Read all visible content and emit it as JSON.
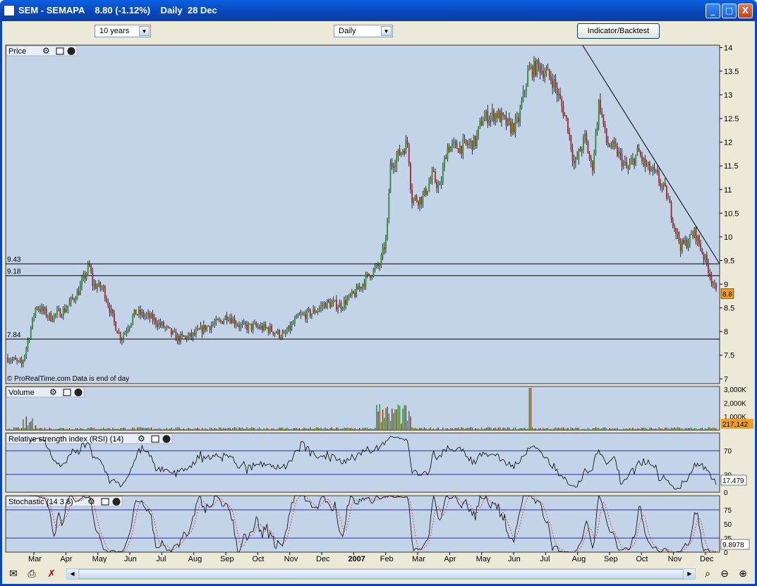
{
  "window": {
    "title": "SEM - SEMAPA    8.80 (-1.12%)    Daily  28 Dec",
    "minimize": "_",
    "maximize": "□",
    "close": "X"
  },
  "toolbar": {
    "period_select": "10 years",
    "interval_select": "Daily",
    "indicator_button": "Indicator/Backtest"
  },
  "colors": {
    "panel_bg": "#c4d4e8",
    "up": "#2a8c2a",
    "down": "#b02020",
    "line": "#000000",
    "reference": "#3030a0",
    "badge": "#f0a020"
  },
  "panels": {
    "price": {
      "title": "Price",
      "current_label": "8.8",
      "watermark": "© ProRealTime.com  Data is end of day"
    },
    "volume": {
      "title": "Volume",
      "current_label": "217,142"
    },
    "rsi": {
      "title": "Relative strength index (RSI) (14)",
      "current_label": "17.479"
    },
    "stoch": {
      "title": "Stochastic (14 3 5)",
      "current_label": "9.8978"
    }
  },
  "chart_data": [
    {
      "type": "candlestick",
      "title": "Price",
      "x_labels": [
        "Mar",
        "Apr",
        "May",
        "Jun",
        "Jul",
        "Aug",
        "Sep",
        "Oct",
        "Nov",
        "Dec",
        "2007",
        "Feb",
        "Mar",
        "Apr",
        "May",
        "Jun",
        "Jul",
        "Aug",
        "Sep",
        "Oct",
        "Nov",
        "Dec"
      ],
      "y_ticks": [
        7,
        7.5,
        8,
        8.5,
        9,
        9.5,
        10,
        10.5,
        11,
        11.5,
        12,
        12.5,
        13,
        13.5,
        14
      ],
      "ylim": [
        6.9,
        14.05
      ],
      "horizontal_lines": [
        {
          "label": "9.43",
          "value": 9.43
        },
        {
          "label": "9.18",
          "value": 9.18
        },
        {
          "label": "7.84",
          "value": 7.84
        }
      ],
      "trendline": [
        [
          0.808,
          14.05
        ],
        [
          1.0,
          9.43
        ]
      ],
      "closes": [
        [
          0.0,
          7.45
        ],
        [
          0.02,
          7.3
        ],
        [
          0.03,
          7.9
        ],
        [
          0.04,
          8.55
        ],
        [
          0.06,
          8.3
        ],
        [
          0.08,
          8.45
        ],
        [
          0.1,
          8.85
        ],
        [
          0.115,
          9.4
        ],
        [
          0.12,
          9.0
        ],
        [
          0.135,
          8.9
        ],
        [
          0.15,
          8.2
        ],
        [
          0.16,
          7.85
        ],
        [
          0.18,
          8.4
        ],
        [
          0.2,
          8.3
        ],
        [
          0.22,
          8.1
        ],
        [
          0.24,
          7.85
        ],
        [
          0.26,
          7.9
        ],
        [
          0.28,
          8.1
        ],
        [
          0.3,
          8.2
        ],
        [
          0.31,
          8.35
        ],
        [
          0.33,
          8.1
        ],
        [
          0.35,
          8.1
        ],
        [
          0.37,
          8.05
        ],
        [
          0.39,
          7.9
        ],
        [
          0.41,
          8.3
        ],
        [
          0.43,
          8.4
        ],
        [
          0.45,
          8.6
        ],
        [
          0.47,
          8.55
        ],
        [
          0.49,
          8.8
        ],
        [
          0.51,
          9.2
        ],
        [
          0.525,
          9.4
        ],
        [
          0.535,
          10.0
        ],
        [
          0.54,
          11.5
        ],
        [
          0.555,
          11.8
        ],
        [
          0.565,
          12.0
        ],
        [
          0.57,
          10.8
        ],
        [
          0.585,
          10.8
        ],
        [
          0.6,
          11.3
        ],
        [
          0.61,
          11.0
        ],
        [
          0.62,
          11.9
        ],
        [
          0.64,
          11.9
        ],
        [
          0.66,
          12.0
        ],
        [
          0.67,
          12.5
        ],
        [
          0.69,
          12.6
        ],
        [
          0.71,
          12.3
        ],
        [
          0.72,
          12.4
        ],
        [
          0.735,
          13.5
        ],
        [
          0.75,
          13.6
        ],
        [
          0.77,
          13.3
        ],
        [
          0.79,
          12.4
        ],
        [
          0.8,
          11.5
        ],
        [
          0.815,
          12.1
        ],
        [
          0.825,
          11.4
        ],
        [
          0.835,
          12.9
        ],
        [
          0.845,
          12.0
        ],
        [
          0.86,
          11.8
        ],
        [
          0.875,
          11.4
        ],
        [
          0.89,
          11.8
        ],
        [
          0.9,
          11.5
        ],
        [
          0.915,
          11.3
        ],
        [
          0.93,
          10.9
        ],
        [
          0.94,
          10.3
        ],
        [
          0.95,
          9.8
        ],
        [
          0.96,
          9.9
        ],
        [
          0.97,
          10.1
        ],
        [
          0.98,
          9.7
        ],
        [
          0.99,
          9.3
        ],
        [
          1.0,
          8.8
        ]
      ]
    },
    {
      "type": "bar",
      "title": "Volume",
      "y_ticks": [
        "3,000K",
        "2,000K",
        "1,000K"
      ],
      "ylim": [
        0,
        3200
      ],
      "units": "K",
      "current": 217.142
    },
    {
      "type": "line",
      "title": "Relative strength index (RSI) (14)",
      "y_ticks": [
        70,
        30,
        0
      ],
      "ylim": [
        0,
        100
      ],
      "reference_lines": [
        70,
        30
      ],
      "current": 17.479
    },
    {
      "type": "line",
      "title": "Stochastic (14 3 5)",
      "y_ticks": [
        75,
        50,
        25,
        0
      ],
      "ylim": [
        0,
        100
      ],
      "reference_lines": [
        75,
        25
      ],
      "current": 9.8978
    }
  ]
}
